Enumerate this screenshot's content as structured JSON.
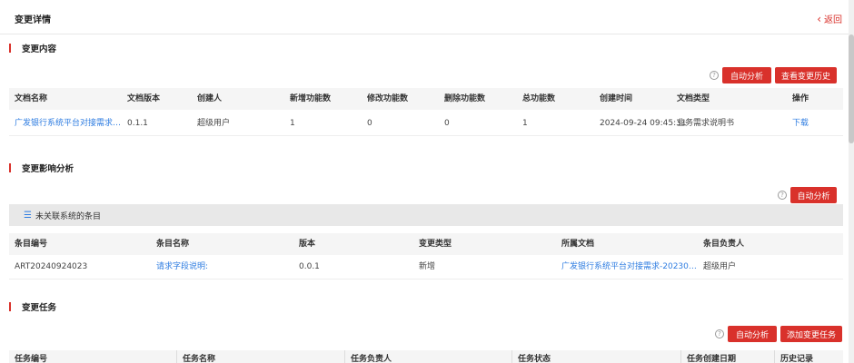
{
  "header": {
    "title": "变更详情",
    "back_label": "返回"
  },
  "change_content": {
    "title": "变更内容",
    "buttons": {
      "auto_analyze": "自动分析",
      "history": "查看变更历史"
    },
    "columns": [
      "文档名称",
      "文档版本",
      "创建人",
      "新增功能数",
      "修改功能数",
      "删除功能数",
      "总功能数",
      "创建时间",
      "文档类型",
      "操作"
    ],
    "rows": [
      {
        "doc_name": "广发银行系统平台对接需求-2...",
        "version": "0.1.1",
        "creator": "超级用户",
        "added": "1",
        "modified": "0",
        "deleted": "0",
        "total": "1",
        "created": "2024-09-24 09:45:31",
        "type": "业务需求说明书",
        "action": "下载"
      }
    ]
  },
  "impact": {
    "title": "变更影响分析",
    "buttons": {
      "auto_analyze": "自动分析"
    },
    "unlinked_label": "未关联系统的条目",
    "columns": [
      "条目编号",
      "条目名称",
      "版本",
      "变更类型",
      "所属文档",
      "条目负责人"
    ],
    "rows": [
      {
        "id": "ART20240924023",
        "name": "请求字段说明:",
        "version": "0.0.1",
        "change_type": "新增",
        "doc": "广发银行系统平台对接需求-20230217 ...",
        "owner": "超级用户"
      }
    ]
  },
  "tasks": {
    "title": "变更任务",
    "buttons": {
      "auto_analyze": "自动分析",
      "add_task": "添加变更任务"
    },
    "columns": [
      "任务编号",
      "任务名称",
      "任务负责人",
      "任务状态",
      "任务创建日期",
      "历史记录"
    ]
  },
  "icons": {
    "back": "chevron-left-icon",
    "help": "question-circle-icon",
    "list": "list-icon"
  },
  "colors": {
    "accent": "#d9312b",
    "link": "#2f7de1"
  }
}
